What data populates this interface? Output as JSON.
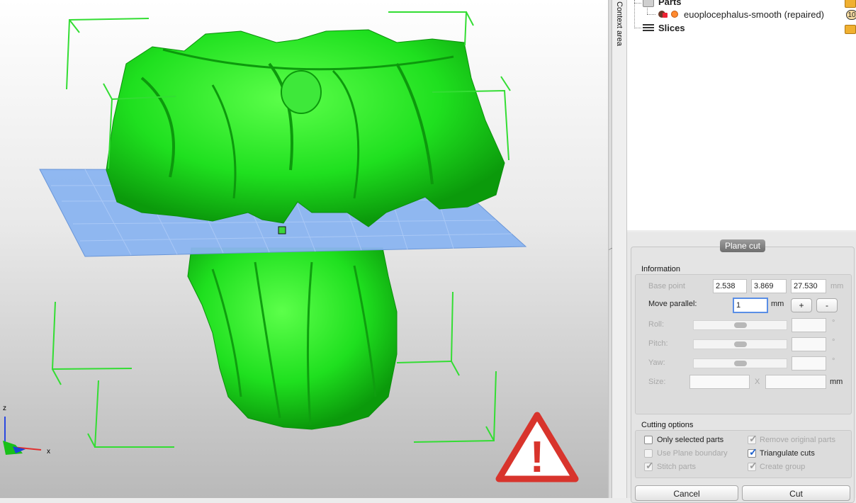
{
  "context_area": {
    "label": "Context area"
  },
  "tree": {
    "parts_label": "Parts",
    "part_name": "euoplocephalus-smooth (repaired)",
    "part_count": "10",
    "slices_label": "Slices"
  },
  "plane_cut": {
    "title": "Plane cut",
    "information": {
      "group_label": "Information",
      "base_point_label": "Base point",
      "base_point_x": "2.538",
      "base_point_y": "3.869",
      "base_point_z": "27.530",
      "base_point_unit": "mm",
      "move_parallel_label": "Move parallel:",
      "move_parallel_value": "1",
      "move_parallel_unit": "mm",
      "plus_label": "+",
      "minus_label": "-",
      "roll_label": "Roll:",
      "pitch_label": "Pitch:",
      "yaw_label": "Yaw:",
      "degree_unit": "°",
      "size_label": "Size:",
      "size_separator": "X",
      "size_unit": "mm"
    },
    "cutting_options": {
      "group_label": "Cutting options",
      "only_selected_parts": {
        "label": "Only selected parts",
        "checked": false,
        "enabled": true
      },
      "remove_original_parts": {
        "label": "Remove original parts",
        "checked": true,
        "enabled": false
      },
      "use_plane_boundary": {
        "label": "Use Plane boundary",
        "checked": false,
        "enabled": false
      },
      "triangulate_cuts": {
        "label": "Triangulate cuts",
        "checked": true,
        "enabled": true
      },
      "stitch_parts": {
        "label": "Stitch parts",
        "checked": true,
        "enabled": false
      },
      "create_group": {
        "label": "Create group",
        "checked": true,
        "enabled": false
      }
    },
    "cancel_label": "Cancel",
    "cut_label": "Cut"
  },
  "axes": {
    "z_label": "z",
    "x_label": "x"
  },
  "warning_symbol": "!",
  "colors": {
    "model": "#1fe01f",
    "bounding_box": "#33dd33",
    "cut_plane": "#8ab4f0",
    "warning_red": "#d8342c"
  }
}
